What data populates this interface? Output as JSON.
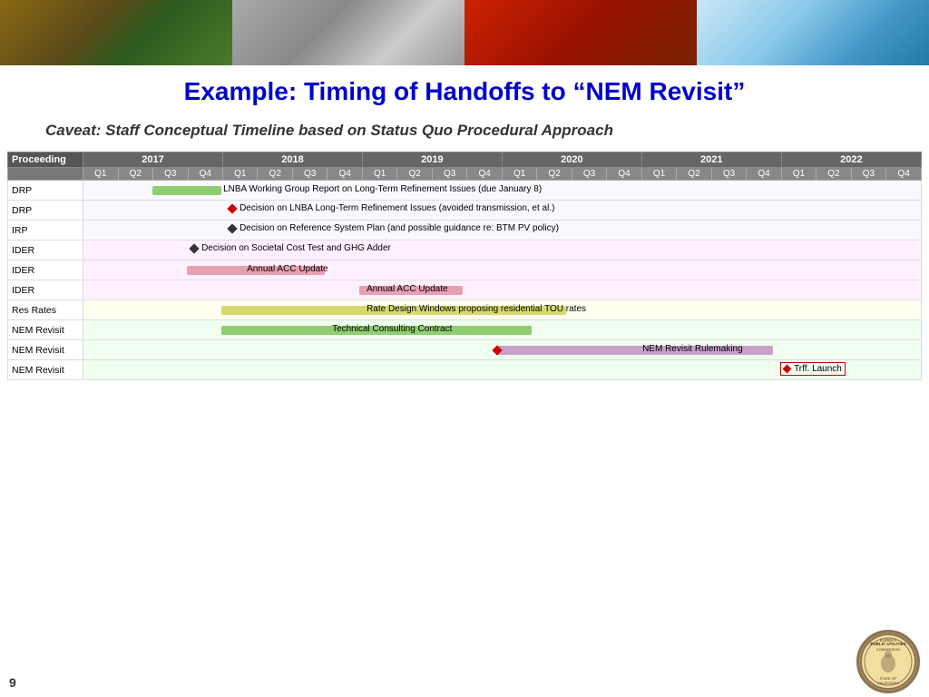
{
  "header": {
    "title": "Example: Timing of Handoffs to “NEM Revisit”",
    "subtitle": "Caveat: Staff Conceptual Timeline based on Status Quo Procedural Approach"
  },
  "gantt": {
    "proc_col_header": "Proceeding",
    "years": [
      "2017",
      "2018",
      "2019",
      "2020",
      "2021",
      "2022"
    ],
    "quarters": [
      "Q1",
      "Q2",
      "Q3",
      "Q4",
      "Q1",
      "Q2",
      "Q3",
      "Q4",
      "Q1",
      "Q2",
      "Q3",
      "Q4",
      "Q1",
      "Q2",
      "Q3",
      "Q4",
      "Q1",
      "Q2",
      "Q3",
      "Q4",
      "Q1",
      "Q2",
      "Q3",
      "Q4"
    ],
    "rows": [
      {
        "proc": "DRP",
        "bar_label": "LNBA Working Group Report on Long-Term Refinement Issues (due January 8)",
        "bar_type": "text_with_bar",
        "bar_color": "green",
        "bar_start_q": 3,
        "bar_end_q": 5,
        "label_start_q": 5
      },
      {
        "proc": "DRP",
        "bar_label": "Decision on LNBA Long-Term Refinement Issues (avoided transmission, et al.)",
        "bar_type": "diamond_text",
        "diamond_color": "red",
        "diamond_q": 5
      },
      {
        "proc": "IRP",
        "bar_label": "Decision on Reference System Plan (and possible guidance re: BTM PV policy)",
        "bar_type": "diamond_text",
        "diamond_color": "dark",
        "diamond_q": 5
      },
      {
        "proc": "IDER",
        "bar_label": "Decision on Societal Cost Test and GHG Adder",
        "bar_type": "diamond_text",
        "diamond_color": "dark",
        "diamond_q": 4
      },
      {
        "proc": "IDER",
        "bar_label": "Annual ACC Update",
        "bar_type": "bar_text",
        "bar_color": "pink",
        "bar_start_q": 4,
        "bar_end_q": 6
      },
      {
        "proc": "IDER",
        "bar_label": "Annual ACC Update",
        "bar_type": "bar_text",
        "bar_color": "pink",
        "bar_start_q": 8,
        "bar_end_q": 10
      },
      {
        "proc": "Res Rates",
        "bar_label": "Rate Design Windows proposing residential TOU rates",
        "bar_type": "bar_text",
        "bar_color": "yellow",
        "bar_start_q": 5,
        "bar_end_q": 14
      },
      {
        "proc": "NEM Revisit",
        "bar_label": "Technical Consulting Contract",
        "bar_type": "bar_text",
        "bar_color": "green",
        "bar_start_q": 5,
        "bar_end_q": 13
      },
      {
        "proc": "NEM Revisit",
        "bar_label": "NEM Revisit Rulemaking",
        "bar_type": "bar_text_with_diamond",
        "bar_color": "purple",
        "bar_start_q": 12,
        "bar_end_q": 20,
        "diamond_q": 12,
        "diamond_color": "red"
      },
      {
        "proc": "NEM Revisit",
        "bar_label": "Trff. Launch",
        "bar_type": "diamond_text_box",
        "diamond_q": 21,
        "diamond_color": "red"
      }
    ]
  },
  "page_number": "9",
  "seal": {
    "text": "PUBLIC UTILITIES COMMISSION STATE OF CALIFORNIA"
  }
}
